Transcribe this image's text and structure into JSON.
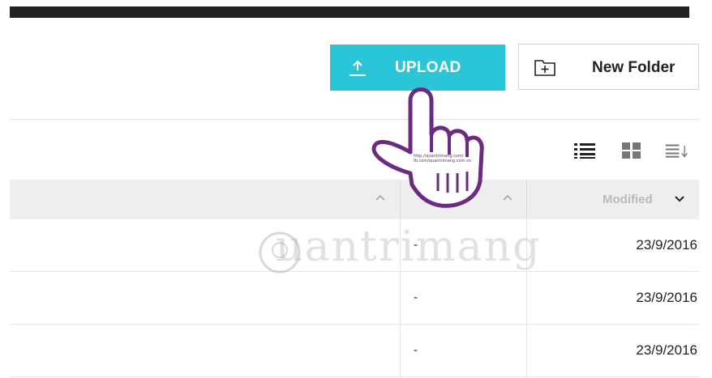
{
  "toolbar": {
    "upload_label": "UPLOAD",
    "new_folder_label": "New Folder",
    "upload_color": "#2ac6d8"
  },
  "view_controls": {
    "icons": [
      "list-view-icon",
      "grid-view-icon",
      "sort-icon"
    ]
  },
  "table": {
    "headers": {
      "modified": "Modified"
    },
    "rows": [
      {
        "size": "-",
        "modified": "23/9/2016"
      },
      {
        "size": "-",
        "modified": "23/9/2016"
      },
      {
        "size": "-",
        "modified": "23/9/2016"
      }
    ]
  },
  "overlay": {
    "watermark_text": "uantrimang",
    "hand_caption": "http://quantrimang.com/ fb.com/quantrimang.com.vn"
  }
}
